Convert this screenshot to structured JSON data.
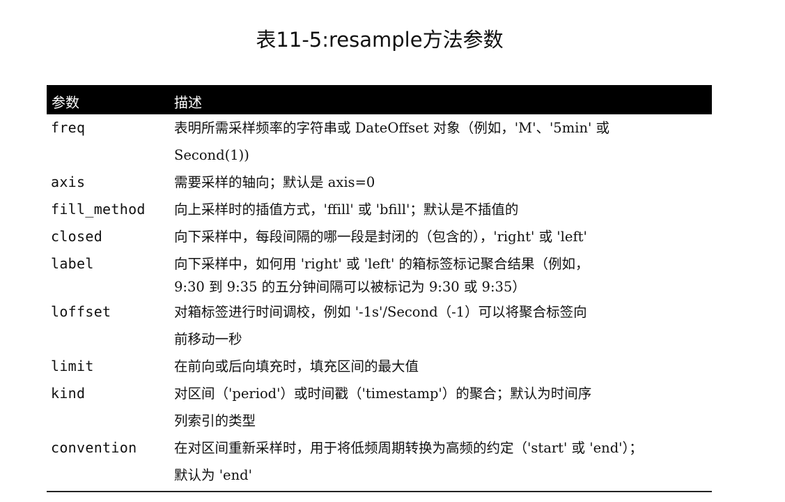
{
  "title": "表11-5:resample方法参数",
  "table": {
    "headers": [
      "参数",
      "描述"
    ],
    "rows": [
      {
        "param": "freq",
        "desc": [
          "表明所需采样频率的字符串或 DateOffset 对象（例如，'M'、'5min' 或",
          "Second(1))"
        ]
      },
      {
        "param": "axis",
        "desc": [
          "需要采样的轴向；默认是 axis=0"
        ]
      },
      {
        "param": "fill_method",
        "desc": [
          "向上采样时的插值方式，'ffill' 或 'bfill'；默认是不插值的"
        ]
      },
      {
        "param": "closed",
        "desc": [
          "向下采样中，每段间隔的哪一段是封闭的（包含的），'right' 或 'left'"
        ]
      },
      {
        "param": "label",
        "desc": [
          "向下采样中，如何用 'right' 或 'left' 的箱标签标记聚合结果（例如，",
          "9:30 到 9:35 的五分钟间隔可以被标记为 9:30 或 9:35）"
        ]
      },
      {
        "param": "loffset",
        "desc": [
          "对箱标签进行时间调校，例如 '-1s'/Second（-1）可以将聚合标签向",
          "前移动一秒"
        ]
      },
      {
        "param": "limit",
        "desc": [
          "在前向或后向填充时，填充区间的最大值"
        ]
      },
      {
        "param": "kind",
        "desc": [
          "对区间（'period'）或时间戳（'timestamp'）的聚合；默认为时间序",
          "列索引的类型"
        ]
      },
      {
        "param": "convention",
        "desc": [
          "在对区间重新采样时，用于将低频周期转换为高频的约定（'start' 或 'end'）；",
          "默认为 'end'"
        ]
      }
    ]
  }
}
